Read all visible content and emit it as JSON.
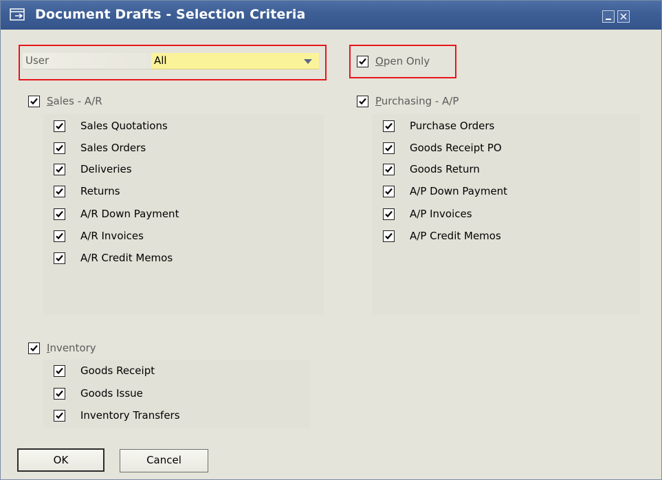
{
  "window": {
    "title": "Document Drafts - Selection Criteria",
    "title_icon": "document-arrow-icon",
    "controls": [
      "minimize-icon",
      "close-icon"
    ],
    "accent_color": "#3e5f96",
    "highlight_color": "#e8141c"
  },
  "user": {
    "label": "User",
    "value": "All"
  },
  "open_only": {
    "label": "Open Only",
    "checked": true
  },
  "sales": {
    "label": "Sales - A/R",
    "checked": true,
    "items": [
      {
        "label": "Sales Quotations",
        "checked": true
      },
      {
        "label": "Sales Orders",
        "checked": true
      },
      {
        "label": "Deliveries",
        "checked": true
      },
      {
        "label": "Returns",
        "checked": true
      },
      {
        "label": "A/R Down Payment",
        "checked": true
      },
      {
        "label": "A/R Invoices",
        "checked": true
      },
      {
        "label": "A/R Credit Memos",
        "checked": true
      }
    ]
  },
  "purchasing": {
    "label": "Purchasing - A/P",
    "checked": true,
    "items": [
      {
        "label": "Purchase Orders",
        "checked": true
      },
      {
        "label": "Goods Receipt PO",
        "checked": true
      },
      {
        "label": "Goods Return",
        "checked": true
      },
      {
        "label": "A/P Down Payment",
        "checked": true
      },
      {
        "label": "A/P Invoices",
        "checked": true
      },
      {
        "label": "A/P Credit Memos",
        "checked": true
      }
    ]
  },
  "inventory": {
    "label": "Inventory",
    "checked": true,
    "items": [
      {
        "label": "Goods Receipt",
        "checked": true
      },
      {
        "label": "Goods Issue",
        "checked": true
      },
      {
        "label": "Inventory Transfers",
        "checked": true
      }
    ]
  },
  "buttons": {
    "ok": "OK",
    "cancel": "Cancel"
  }
}
